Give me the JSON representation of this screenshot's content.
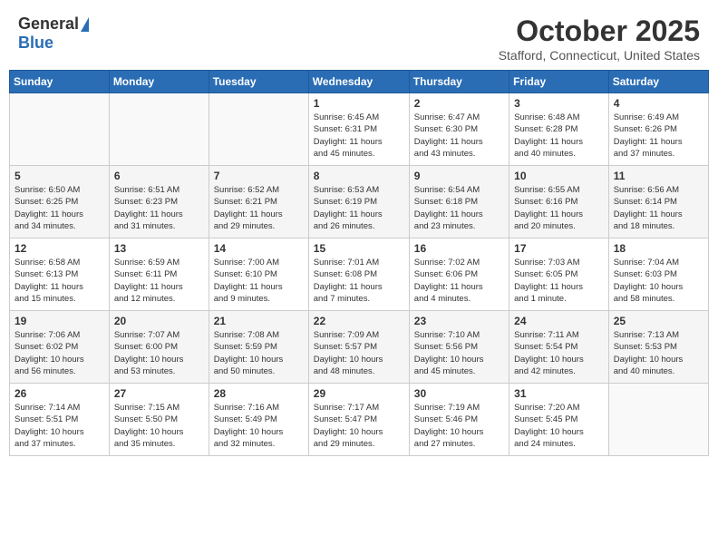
{
  "header": {
    "logo_general": "General",
    "logo_blue": "Blue",
    "month": "October 2025",
    "location": "Stafford, Connecticut, United States"
  },
  "weekdays": [
    "Sunday",
    "Monday",
    "Tuesday",
    "Wednesday",
    "Thursday",
    "Friday",
    "Saturday"
  ],
  "weeks": [
    [
      {
        "day": "",
        "info": ""
      },
      {
        "day": "",
        "info": ""
      },
      {
        "day": "",
        "info": ""
      },
      {
        "day": "1",
        "info": "Sunrise: 6:45 AM\nSunset: 6:31 PM\nDaylight: 11 hours\nand 45 minutes."
      },
      {
        "day": "2",
        "info": "Sunrise: 6:47 AM\nSunset: 6:30 PM\nDaylight: 11 hours\nand 43 minutes."
      },
      {
        "day": "3",
        "info": "Sunrise: 6:48 AM\nSunset: 6:28 PM\nDaylight: 11 hours\nand 40 minutes."
      },
      {
        "day": "4",
        "info": "Sunrise: 6:49 AM\nSunset: 6:26 PM\nDaylight: 11 hours\nand 37 minutes."
      }
    ],
    [
      {
        "day": "5",
        "info": "Sunrise: 6:50 AM\nSunset: 6:25 PM\nDaylight: 11 hours\nand 34 minutes."
      },
      {
        "day": "6",
        "info": "Sunrise: 6:51 AM\nSunset: 6:23 PM\nDaylight: 11 hours\nand 31 minutes."
      },
      {
        "day": "7",
        "info": "Sunrise: 6:52 AM\nSunset: 6:21 PM\nDaylight: 11 hours\nand 29 minutes."
      },
      {
        "day": "8",
        "info": "Sunrise: 6:53 AM\nSunset: 6:19 PM\nDaylight: 11 hours\nand 26 minutes."
      },
      {
        "day": "9",
        "info": "Sunrise: 6:54 AM\nSunset: 6:18 PM\nDaylight: 11 hours\nand 23 minutes."
      },
      {
        "day": "10",
        "info": "Sunrise: 6:55 AM\nSunset: 6:16 PM\nDaylight: 11 hours\nand 20 minutes."
      },
      {
        "day": "11",
        "info": "Sunrise: 6:56 AM\nSunset: 6:14 PM\nDaylight: 11 hours\nand 18 minutes."
      }
    ],
    [
      {
        "day": "12",
        "info": "Sunrise: 6:58 AM\nSunset: 6:13 PM\nDaylight: 11 hours\nand 15 minutes."
      },
      {
        "day": "13",
        "info": "Sunrise: 6:59 AM\nSunset: 6:11 PM\nDaylight: 11 hours\nand 12 minutes."
      },
      {
        "day": "14",
        "info": "Sunrise: 7:00 AM\nSunset: 6:10 PM\nDaylight: 11 hours\nand 9 minutes."
      },
      {
        "day": "15",
        "info": "Sunrise: 7:01 AM\nSunset: 6:08 PM\nDaylight: 11 hours\nand 7 minutes."
      },
      {
        "day": "16",
        "info": "Sunrise: 7:02 AM\nSunset: 6:06 PM\nDaylight: 11 hours\nand 4 minutes."
      },
      {
        "day": "17",
        "info": "Sunrise: 7:03 AM\nSunset: 6:05 PM\nDaylight: 11 hours\nand 1 minute."
      },
      {
        "day": "18",
        "info": "Sunrise: 7:04 AM\nSunset: 6:03 PM\nDaylight: 10 hours\nand 58 minutes."
      }
    ],
    [
      {
        "day": "19",
        "info": "Sunrise: 7:06 AM\nSunset: 6:02 PM\nDaylight: 10 hours\nand 56 minutes."
      },
      {
        "day": "20",
        "info": "Sunrise: 7:07 AM\nSunset: 6:00 PM\nDaylight: 10 hours\nand 53 minutes."
      },
      {
        "day": "21",
        "info": "Sunrise: 7:08 AM\nSunset: 5:59 PM\nDaylight: 10 hours\nand 50 minutes."
      },
      {
        "day": "22",
        "info": "Sunrise: 7:09 AM\nSunset: 5:57 PM\nDaylight: 10 hours\nand 48 minutes."
      },
      {
        "day": "23",
        "info": "Sunrise: 7:10 AM\nSunset: 5:56 PM\nDaylight: 10 hours\nand 45 minutes."
      },
      {
        "day": "24",
        "info": "Sunrise: 7:11 AM\nSunset: 5:54 PM\nDaylight: 10 hours\nand 42 minutes."
      },
      {
        "day": "25",
        "info": "Sunrise: 7:13 AM\nSunset: 5:53 PM\nDaylight: 10 hours\nand 40 minutes."
      }
    ],
    [
      {
        "day": "26",
        "info": "Sunrise: 7:14 AM\nSunset: 5:51 PM\nDaylight: 10 hours\nand 37 minutes."
      },
      {
        "day": "27",
        "info": "Sunrise: 7:15 AM\nSunset: 5:50 PM\nDaylight: 10 hours\nand 35 minutes."
      },
      {
        "day": "28",
        "info": "Sunrise: 7:16 AM\nSunset: 5:49 PM\nDaylight: 10 hours\nand 32 minutes."
      },
      {
        "day": "29",
        "info": "Sunrise: 7:17 AM\nSunset: 5:47 PM\nDaylight: 10 hours\nand 29 minutes."
      },
      {
        "day": "30",
        "info": "Sunrise: 7:19 AM\nSunset: 5:46 PM\nDaylight: 10 hours\nand 27 minutes."
      },
      {
        "day": "31",
        "info": "Sunrise: 7:20 AM\nSunset: 5:45 PM\nDaylight: 10 hours\nand 24 minutes."
      },
      {
        "day": "",
        "info": ""
      }
    ]
  ]
}
